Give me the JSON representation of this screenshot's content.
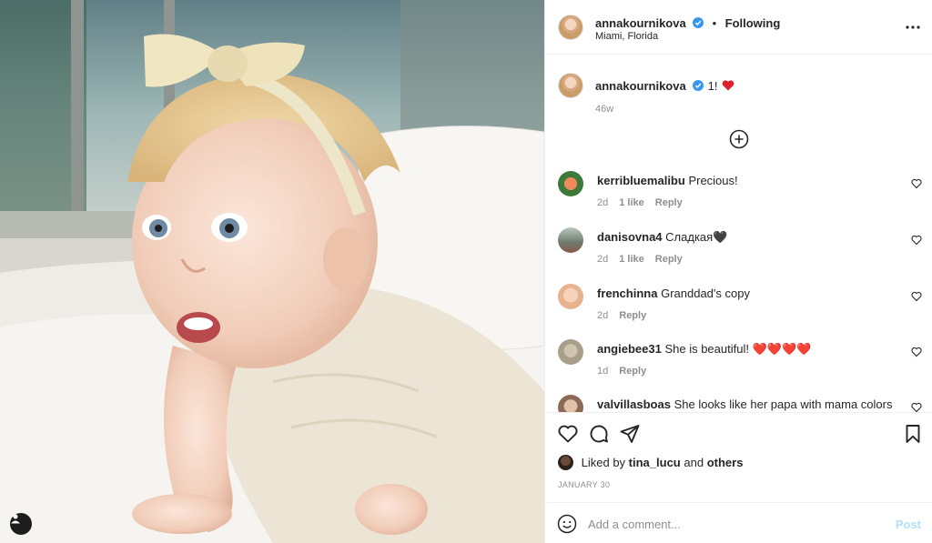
{
  "post": {
    "username": "annakournikova",
    "follow_state": "Following",
    "location": "Miami, Florida",
    "caption_text": "1!",
    "caption_time": "46w"
  },
  "comments": [
    {
      "username": "kerribluemalibu",
      "text": "Precious!",
      "time": "2d",
      "likes": "1 like",
      "reply": "Reply",
      "avatar_color": "#d87a5a"
    },
    {
      "username": "danisovna4",
      "text": "Сладкая🖤",
      "time": "2d",
      "likes": "1 like",
      "reply": "Reply",
      "avatar_color": "#6d7a6a"
    },
    {
      "username": "frenchinna",
      "text": "Granddad's copy",
      "time": "2d",
      "likes": "",
      "reply": "Reply",
      "avatar_color": "#e7b38f"
    },
    {
      "username": "angiebee31",
      "text": "She is beautiful! ❤️❤️❤️❤️",
      "time": "1d",
      "likes": "",
      "reply": "Reply",
      "avatar_color": "#a89e8a"
    },
    {
      "username": "valvillasboas",
      "text": "She looks like her papa with mama colors 🥰❤️",
      "time": "",
      "likes": "",
      "reply": "",
      "avatar_color": "#8a6a55"
    }
  ],
  "likes": {
    "prefix": "Liked by",
    "user": "tina_lucu",
    "joiner": "and",
    "others": "others"
  },
  "date": "JANUARY 30",
  "comment_box": {
    "placeholder": "Add a comment...",
    "post_label": "Post"
  },
  "colors": {
    "heart_red": "#ed4956",
    "verified_blue": "#3897f0",
    "post_disabled": "#b2dffc"
  },
  "icons": [
    "more-options-icon",
    "verified-icon",
    "load-more-icon",
    "heart-icon",
    "comment-icon",
    "share-icon",
    "bookmark-icon",
    "emoji-icon",
    "user-tag-icon"
  ]
}
